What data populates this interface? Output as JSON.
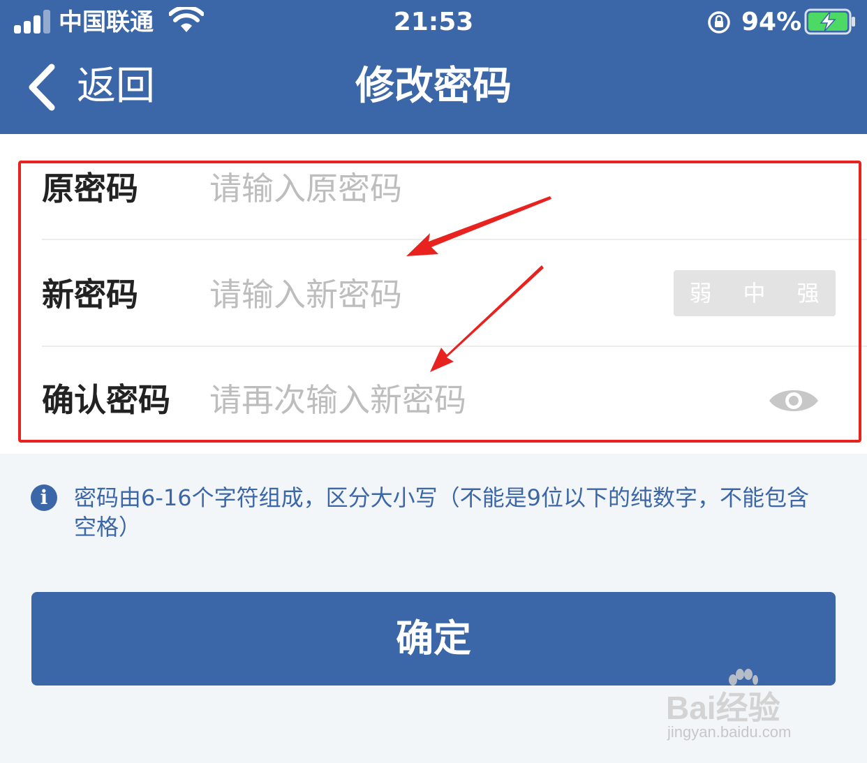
{
  "status_bar": {
    "carrier": "中国联通",
    "time": "21:53",
    "battery_percent": "94%",
    "signal_bars": 3,
    "icons": [
      "signal-icon",
      "wifi-icon",
      "orientation-lock-icon",
      "battery-charging-icon"
    ]
  },
  "nav": {
    "back_label": "返回",
    "title": "修改密码"
  },
  "form": {
    "old_password": {
      "label": "原密码",
      "placeholder": "请输入原密码",
      "value": ""
    },
    "new_password": {
      "label": "新密码",
      "placeholder": "请输入新密码",
      "value": "",
      "strength_levels": [
        "弱",
        "中",
        "强"
      ]
    },
    "confirm_password": {
      "label": "确认密码",
      "placeholder": "请再次输入新密码",
      "value": ""
    }
  },
  "hint": {
    "text": "密码由6-16个字符组成，区分大小写（不能是9位以下的纯数字，不能包含空格）"
  },
  "confirm_button": {
    "label": "确定"
  },
  "watermark": {
    "brand": "Bai经验",
    "url": "jingyan.baidu.com"
  },
  "colors": {
    "primary": "#3b66a7",
    "annotation": "#e8231f",
    "placeholder": "#bdbdbd",
    "background": "#f3f6f8"
  }
}
